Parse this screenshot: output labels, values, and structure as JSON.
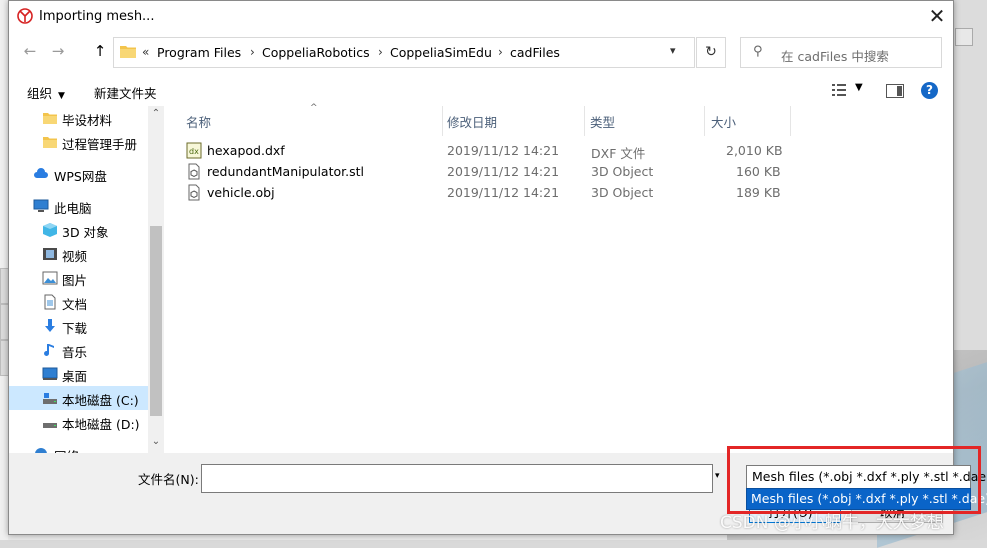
{
  "dialog": {
    "title": "Importing mesh...",
    "close_glyph": "✕"
  },
  "nav": {
    "back": "←",
    "forward": "→",
    "up": "↑",
    "breadcrumb_prefix": "«",
    "breadcrumbs": [
      "Program Files",
      "CoppeliaRobotics",
      "CoppeliaSimEdu",
      "cadFiles"
    ],
    "search_placeholder": "在 cadFiles 中搜索"
  },
  "toolbar": {
    "organize": "组织",
    "new_folder": "新建文件夹"
  },
  "sidebar": {
    "items": [
      {
        "label": "毕设材料",
        "icon": "folder-icon"
      },
      {
        "label": "过程管理手册",
        "icon": "folder-icon"
      },
      {
        "label": "WPS网盘",
        "icon": "cloud-icon"
      },
      {
        "label": "此电脑",
        "icon": "computer-icon"
      },
      {
        "label": "3D 对象",
        "icon": "3d-objects-icon"
      },
      {
        "label": "视频",
        "icon": "video-icon"
      },
      {
        "label": "图片",
        "icon": "pictures-icon"
      },
      {
        "label": "文档",
        "icon": "documents-icon"
      },
      {
        "label": "下载",
        "icon": "download-icon"
      },
      {
        "label": "音乐",
        "icon": "music-icon"
      },
      {
        "label": "桌面",
        "icon": "desktop-icon"
      },
      {
        "label": "本地磁盘 (C:)",
        "icon": "drive-icon",
        "selected": true
      },
      {
        "label": "本地磁盘 (D:)",
        "icon": "drive-icon"
      },
      {
        "label": "网络",
        "icon": "network-icon"
      }
    ]
  },
  "filelist": {
    "columns": [
      "名称",
      "修改日期",
      "类型",
      "大小"
    ],
    "rows": [
      {
        "name": "hexapod.dxf",
        "date": "2019/11/12 14:21",
        "type": "DXF 文件",
        "size": "2,010 KB",
        "icon": "dxf-file-icon"
      },
      {
        "name": "redundantManipulator.stl",
        "date": "2019/11/12 14:21",
        "type": "3D Object",
        "size": "160 KB",
        "icon": "3d-file-icon"
      },
      {
        "name": "vehicle.obj",
        "date": "2019/11/12 14:21",
        "type": "3D Object",
        "size": "189 KB",
        "icon": "3d-file-icon"
      }
    ]
  },
  "bottom": {
    "filename_label": "文件名(N):",
    "filename_value": "",
    "filetype_selected": "Mesh files (*.obj *.dxf *.ply *.stl *.dae)",
    "filetype_option": "Mesh files (*.obj *.dxf *.ply *.stl *.dae)",
    "open_label": "打开(O)",
    "cancel_label": "取消"
  },
  "watermark": "CSDN @小小蜗牛，大大梦想",
  "colors": {
    "accent": "#0a64c8",
    "highlight": "#e32626",
    "selection": "#cce8ff"
  }
}
